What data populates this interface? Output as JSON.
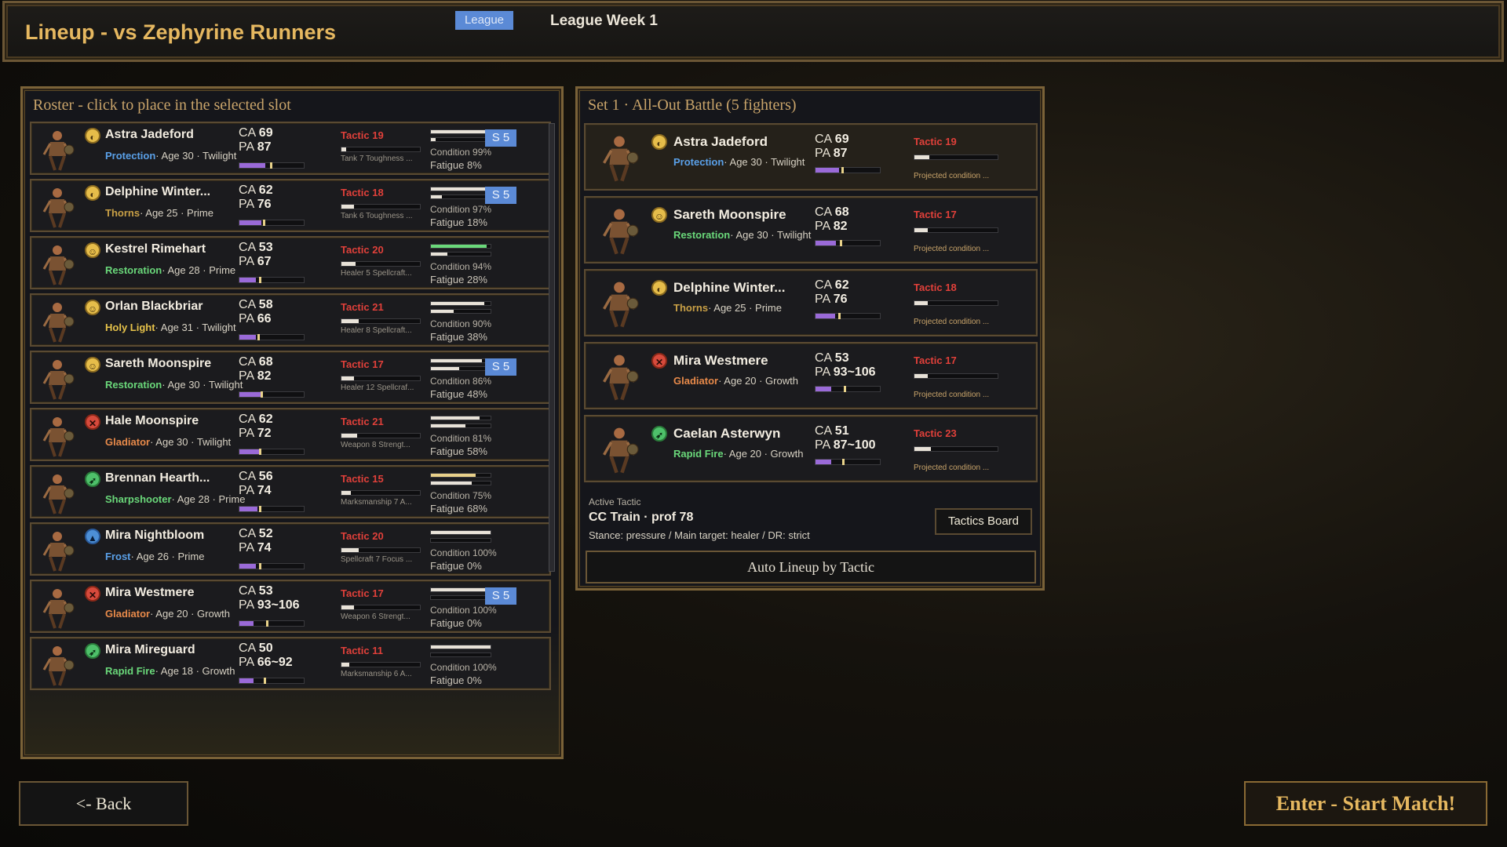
{
  "header": {
    "title": "Lineup - vs Zephyrine Runners",
    "badge": "League",
    "week": "League Week 1"
  },
  "roster": {
    "heading": "Roster - click to place in the selected slot",
    "players": [
      {
        "name": "Astra Jadeford",
        "role": "Protection",
        "role_color": "#5aa0e8",
        "icon": "shield-icon",
        "icon_class": "pi-gold",
        "icon_glyph": "◐",
        "sub": "· Age 30 · Twilight",
        "ca": "69",
        "pa": "87",
        "ca_frac": 0.4,
        "pa_frac": 0.47,
        "tactic": "Tactic 19",
        "tactic_frac": 0.06,
        "tnote": "Tank 7 Toughness ...",
        "cond": "Condition 99%",
        "cond_frac": 0.99,
        "cond_color": "#e8e2d8",
        "fat": "Fatigue 8%",
        "badge": "S 5"
      },
      {
        "name": "Delphine Winter...",
        "role": "Thorns",
        "role_color": "#c9a046",
        "icon": "shield-icon",
        "icon_class": "pi-gold",
        "icon_glyph": "◐",
        "sub": "· Age 25 · Prime",
        "ca": "62",
        "pa": "76",
        "ca_frac": 0.34,
        "pa_frac": 0.37,
        "tactic": "Tactic 18",
        "tactic_frac": 0.16,
        "tnote": "Tank 6 Toughness ...",
        "cond": "Condition 97%",
        "cond_frac": 0.97,
        "cond_color": "#e8e2d8",
        "fat": "Fatigue 18%",
        "badge": "S 5"
      },
      {
        "name": "Kestrel Rimehart",
        "role": "Restoration",
        "role_color": "#6ad87a",
        "icon": "heal-icon",
        "icon_class": "pi-gold",
        "icon_glyph": "☺",
        "sub": "· Age 28 · Prime",
        "ca": "53",
        "pa": "67",
        "ca_frac": 0.26,
        "pa_frac": 0.3,
        "tactic": "Tactic 20",
        "tactic_frac": 0.18,
        "tnote": "Healer 5 Spellcraft...",
        "cond": "Condition 94%",
        "cond_frac": 0.94,
        "cond_color": "#6ad87a",
        "fat": "Fatigue 28%",
        "badge": ""
      },
      {
        "name": "Orlan Blackbriar",
        "role": "Holy Light",
        "role_color": "#e6c24a",
        "icon": "heal-icon",
        "icon_class": "pi-gold",
        "icon_glyph": "☺",
        "sub": "· Age 31 · Twilight",
        "ca": "58",
        "pa": "66",
        "ca_frac": 0.26,
        "pa_frac": 0.28,
        "tactic": "Tactic 21",
        "tactic_frac": 0.22,
        "tnote": "Healer 8 Spellcraft...",
        "cond": "Condition 90%",
        "cond_frac": 0.9,
        "cond_color": "#e8e2d8",
        "fat": "Fatigue 38%",
        "badge": ""
      },
      {
        "name": "Sareth Moonspire",
        "role": "Restoration",
        "role_color": "#6ad87a",
        "icon": "heal-icon",
        "icon_class": "pi-gold",
        "icon_glyph": "☺",
        "sub": "· Age 30 · Twilight",
        "ca": "68",
        "pa": "82",
        "ca_frac": 0.34,
        "pa_frac": 0.33,
        "tactic": "Tactic 17",
        "tactic_frac": 0.16,
        "tnote": "Healer 12 Spellcraf...",
        "cond": "Condition 86%",
        "cond_frac": 0.86,
        "cond_color": "#e8e2d8",
        "fat": "Fatigue 48%",
        "badge": "S 5"
      },
      {
        "name": "Hale Moonspire",
        "role": "Gladiator",
        "role_color": "#e88a4a",
        "icon": "crossed-swords-icon",
        "icon_class": "pi-red",
        "icon_glyph": "✕",
        "sub": "· Age 30 · Twilight",
        "ca": "62",
        "pa": "72",
        "ca_frac": 0.3,
        "pa_frac": 0.3,
        "tactic": "Tactic 21",
        "tactic_frac": 0.2,
        "tnote": "Weapon 8 Strengt...",
        "cond": "Condition 81%",
        "cond_frac": 0.81,
        "cond_color": "#e8e2d8",
        "fat": "Fatigue 58%",
        "badge": ""
      },
      {
        "name": "Brennan Hearth...",
        "role": "Sharpshooter",
        "role_color": "#6ad87a",
        "icon": "bow-icon",
        "icon_class": "pi-green",
        "icon_glyph": "➶",
        "sub": "· Age 28 · Prime",
        "ca": "56",
        "pa": "74",
        "ca_frac": 0.28,
        "pa_frac": 0.3,
        "tactic": "Tactic 15",
        "tactic_frac": 0.12,
        "tnote": "Marksmanship 7 A...",
        "cond": "Condition 75%",
        "cond_frac": 0.75,
        "cond_color": "#e8d08a",
        "fat": "Fatigue 68%",
        "badge": ""
      },
      {
        "name": "Mira Nightbloom",
        "role": "Frost",
        "role_color": "#5aa0e8",
        "icon": "frost-icon",
        "icon_class": "pi-blue",
        "icon_glyph": "▲",
        "sub": "· Age 26 · Prime",
        "ca": "52",
        "pa": "74",
        "ca_frac": 0.26,
        "pa_frac": 0.3,
        "tactic": "Tactic 20",
        "tactic_frac": 0.22,
        "tnote": "Spellcraft 7 Focus ...",
        "cond": "Condition 100%",
        "cond_frac": 1.0,
        "cond_color": "#e8e2d8",
        "fat": "Fatigue 0%",
        "badge": ""
      },
      {
        "name": "Mira Westmere",
        "role": "Gladiator",
        "role_color": "#e88a4a",
        "icon": "crossed-swords-icon",
        "icon_class": "pi-red",
        "icon_glyph": "✕",
        "sub": "· Age 20 · Growth",
        "ca": "53",
        "pa": "93~106",
        "ca_frac": 0.22,
        "pa_frac": 0.42,
        "tactic": "Tactic 17",
        "tactic_frac": 0.16,
        "tnote": "Weapon 6 Strengt...",
        "cond": "Condition 100%",
        "cond_frac": 1.0,
        "cond_color": "#e8e2d8",
        "fat": "Fatigue 0%",
        "badge": "S 5"
      },
      {
        "name": "Mira Mireguard",
        "role": "Rapid Fire",
        "role_color": "#6ad87a",
        "icon": "bow-icon",
        "icon_class": "pi-green",
        "icon_glyph": "➶",
        "sub": "· Age 18 · Growth",
        "ca": "50",
        "pa": "66~92",
        "ca_frac": 0.22,
        "pa_frac": 0.38,
        "tactic": "Tactic 11",
        "tactic_frac": 0.1,
        "tnote": "Marksmanship 6 A...",
        "cond": "Condition 100%",
        "cond_frac": 1.0,
        "cond_color": "#e8e2d8",
        "fat": "Fatigue 0%",
        "badge": ""
      }
    ]
  },
  "set": {
    "heading": "Set 1 · All-Out Battle (5 fighters)",
    "fighters": [
      {
        "name": "Astra Jadeford",
        "role": "Protection",
        "role_color": "#5aa0e8",
        "icon": "shield-icon",
        "icon_class": "pi-gold",
        "icon_glyph": "◐",
        "sub": "· Age 30 · Twilight",
        "ca": "69",
        "pa": "87",
        "ca_frac": 0.36,
        "pa_frac": 0.4,
        "tactic": "Tactic 19",
        "tactic_frac": 0.18,
        "proj": "Projected condition ..."
      },
      {
        "name": "Sareth Moonspire",
        "role": "Restoration",
        "role_color": "#6ad87a",
        "icon": "heal-icon",
        "icon_class": "pi-gold",
        "icon_glyph": "☺",
        "sub": "· Age 30 · Twilight",
        "ca": "68",
        "pa": "82",
        "ca_frac": 0.32,
        "pa_frac": 0.38,
        "tactic": "Tactic 17",
        "tactic_frac": 0.16,
        "proj": "Projected condition ..."
      },
      {
        "name": "Delphine Winter...",
        "role": "Thorns",
        "role_color": "#c9a046",
        "icon": "shield-icon",
        "icon_class": "pi-gold",
        "icon_glyph": "◐",
        "sub": "· Age 25 · Prime",
        "ca": "62",
        "pa": "76",
        "ca_frac": 0.3,
        "pa_frac": 0.35,
        "tactic": "Tactic 18",
        "tactic_frac": 0.16,
        "proj": "Projected condition ..."
      },
      {
        "name": "Mira Westmere",
        "role": "Gladiator",
        "role_color": "#e88a4a",
        "icon": "crossed-swords-icon",
        "icon_class": "pi-red",
        "icon_glyph": "✕",
        "sub": "· Age 20 · Growth",
        "ca": "53",
        "pa": "93~106",
        "ca_frac": 0.24,
        "pa_frac": 0.44,
        "tactic": "Tactic 17",
        "tactic_frac": 0.16,
        "proj": "Projected condition ..."
      },
      {
        "name": "Caelan Asterwyn",
        "role": "Rapid Fire",
        "role_color": "#6ad87a",
        "icon": "bow-icon",
        "icon_class": "pi-green",
        "icon_glyph": "➶",
        "sub": "· Age 20 · Growth",
        "ca": "51",
        "pa": "87~100",
        "ca_frac": 0.24,
        "pa_frac": 0.42,
        "tactic": "Tactic 23",
        "tactic_frac": 0.2,
        "proj": "Projected condition ..."
      }
    ],
    "active_label": "Active Tactic",
    "active_name": "CC Train · prof 78",
    "active_desc": "Stance: pressure / Main target: healer / DR: strict",
    "tactics_button": "Tactics Board",
    "auto_button": "Auto Lineup by Tactic"
  },
  "footer": {
    "back": "<- Back",
    "start": "Enter - Start Match!"
  }
}
